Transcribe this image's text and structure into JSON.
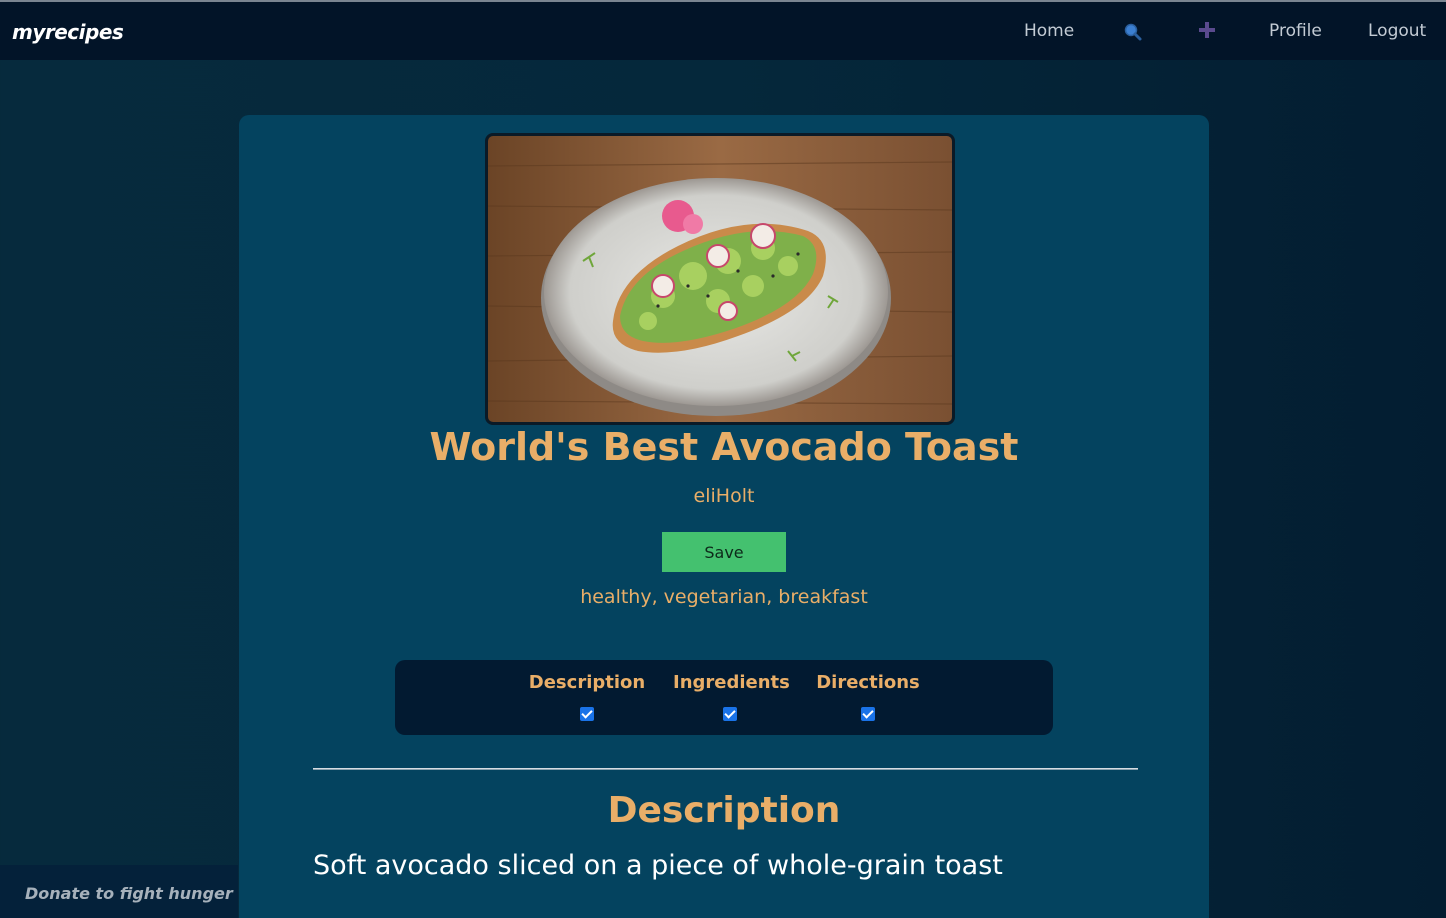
{
  "nav": {
    "brand": "myrecipes",
    "home": "Home",
    "search_icon": "search-icon",
    "add_icon": "plus-icon",
    "profile": "Profile",
    "logout": "Logout"
  },
  "recipe": {
    "image": "avocado-toast-photo",
    "title": "World's Best Avocado Toast",
    "author": "eliHolt",
    "save_label": "Save",
    "tags": "healthy, vegetarian, breakfast"
  },
  "toggles": {
    "description": {
      "label": "Description",
      "checked": true
    },
    "ingredients": {
      "label": "Ingredients",
      "checked": true
    },
    "directions": {
      "label": "Directions",
      "checked": true
    }
  },
  "section": {
    "title": "Description",
    "text": "Soft avocado sliced on a piece of whole-grain toast"
  },
  "footer": {
    "donate": "Donate to fight hunger"
  },
  "colors": {
    "accent": "#e9ae68",
    "save": "#44c16f",
    "card": "#04435f",
    "navbar": "#021428"
  }
}
